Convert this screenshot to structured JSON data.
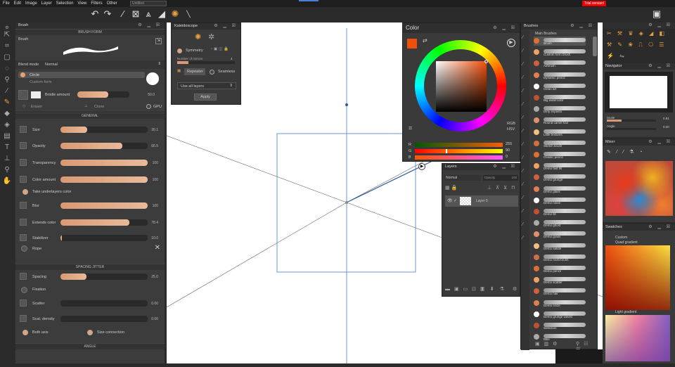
{
  "menu": [
    "File",
    "Edit",
    "Image",
    "Layer",
    "Selection",
    "View",
    "Filters",
    "Other"
  ],
  "document_name": "Untitled",
  "trial_label": "Trial version!",
  "brush_panel": {
    "title": "Brush",
    "brush_form_header": "BRUSH FORM",
    "brush_name": "Brush",
    "blend_mode_label": "Blend mode",
    "blend_mode_value": "Normal",
    "form_circle": "Circle",
    "form_custom": "Custom form",
    "bristle_label": "Bristle amount",
    "bristle_value": "50.0",
    "bristle_pct": 0.6,
    "eraser_label": "Eraser",
    "clone_label": "Clone",
    "gpu_label": "GPU",
    "general_header": "GENERAL",
    "general": [
      {
        "label": "Size",
        "value": "30.1",
        "pct": 0.31
      },
      {
        "label": "Opacity",
        "value": "66.5",
        "pct": 0.71
      },
      {
        "label": "Transparency",
        "value": "100",
        "pct": 1.0
      },
      {
        "label": "Color amount",
        "value": "100",
        "pct": 1.0
      },
      {
        "label": "Blur",
        "value": "100",
        "pct": 1.0
      },
      {
        "label": "Extends color",
        "value": "78.4",
        "pct": 0.79
      },
      {
        "label": "Stabilizer",
        "value": "10.0",
        "pct": 0.02
      }
    ],
    "take_underlayers": "Take underlayers color",
    "rope_label": "Rope",
    "spacing_header": "SPACING JITTER",
    "spacing": {
      "label": "Spacing",
      "value": "25.0",
      "pct": 0.3
    },
    "fixation_label": "Fixation",
    "scatter": {
      "label": "Scatter",
      "value": "0.00",
      "pct": 0.0
    },
    "scat_density": {
      "label": "Scat. density",
      "value": "0.00",
      "pct": 0.0
    },
    "both_axis": "Both axis",
    "size_connection": "Size connection",
    "angle_header": "ANGLE"
  },
  "kaleidoscope": {
    "title": "Kaleidoscope",
    "symmetry_label": "Symmetry",
    "mirrors_label": "Number of mirrors",
    "mirrors_value": "4",
    "repeater_label": "Repeater",
    "seamless_label": "Seamless",
    "layers_select": "Use all layers",
    "apply_label": "Apply"
  },
  "color": {
    "title": "Color",
    "modes": [
      "RGB",
      "HSV"
    ],
    "r_label": "R",
    "g_label": "G",
    "b_label": "B",
    "r_value": "255",
    "g_value": "90",
    "b_value": "0",
    "accent": "#f04f0a"
  },
  "layers": {
    "title": "Layers",
    "blend": "Normal",
    "opacity_label": "Opacity",
    "opacity_value": "100",
    "layer_name": "Layer 0"
  },
  "brushes": {
    "title": "Brushes",
    "group": "Main Brushes",
    "items": [
      "Brush",
      "Custom form brush",
      "Airbrush",
      "Dynamic pencil",
      "Clean art",
      "Big watercolor",
      "Dirty impasto",
      "Round camel hair",
      "Little textures",
      "Sketch brush",
      "Classic pencil",
      "Demo fast fill",
      "Demo grunge",
      "Demo glass",
      "Demo noise",
      "Demo fill",
      "Demo ghost",
      "Demo grass",
      "Demo salute",
      "Demo multi-brush",
      "Demo pencil",
      "Demo scatter",
      "Demo hair",
      "Demo circle",
      "Demo grunge waves",
      "Selection",
      "Bike"
    ]
  },
  "navigator": {
    "title": "Navigator",
    "scale_label": "Scale",
    "scale_value": "0.81",
    "angle_label": "Angle",
    "angle_value": "0.00"
  },
  "mixer": {
    "title": "Mixer"
  },
  "swatches": {
    "title": "Swatches",
    "custom_label": "Custom",
    "quad_label": "Quad gradient",
    "light_label": "Light gradient"
  }
}
